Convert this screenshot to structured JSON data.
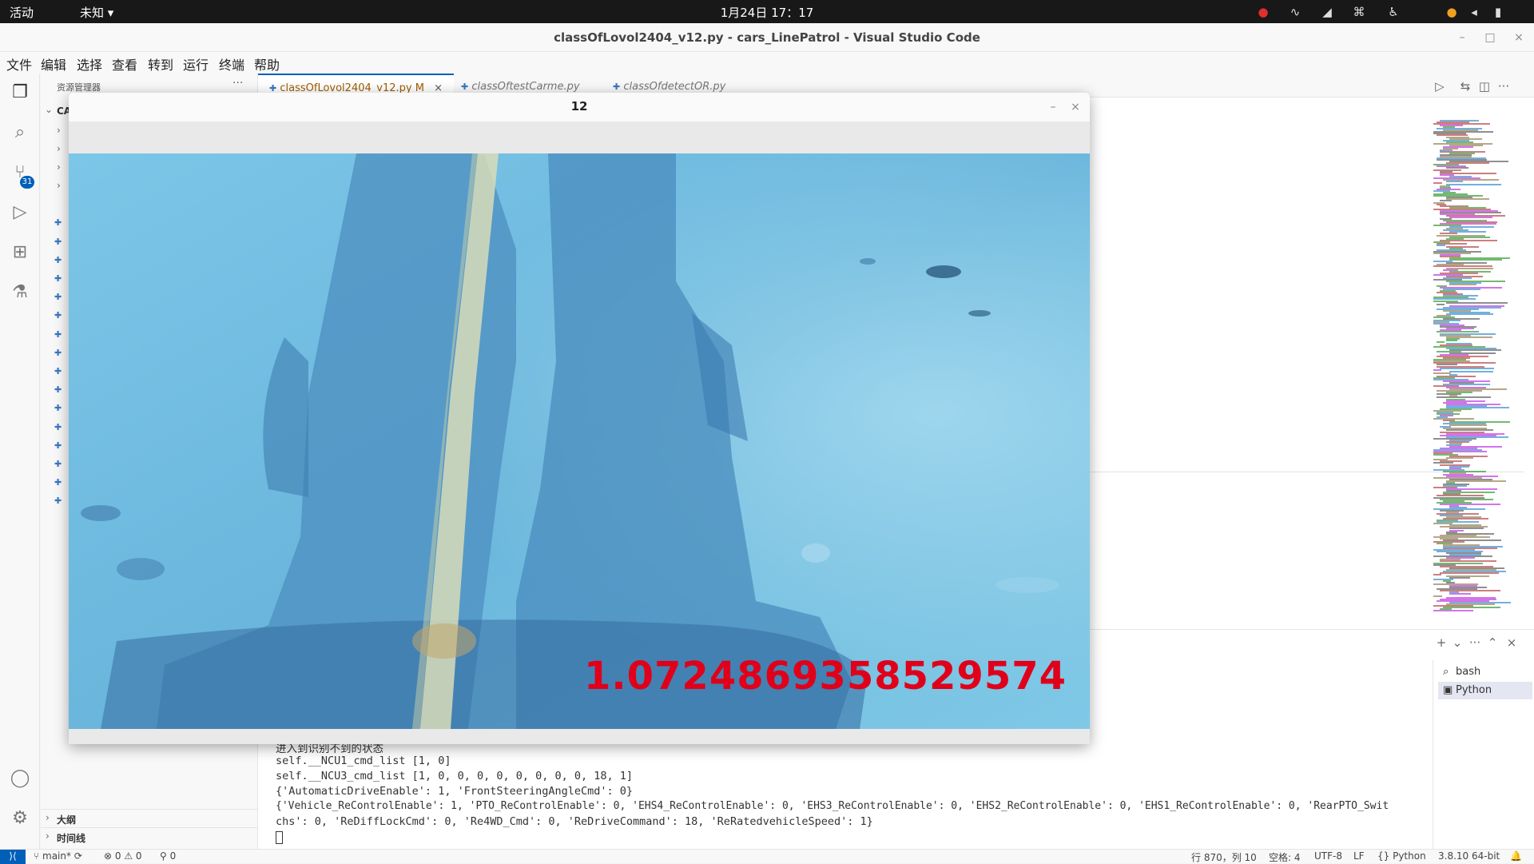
{
  "topbar": {
    "activities": "活动",
    "unknown": "未知 ▾",
    "clock": "1月24日  17：17"
  },
  "window": {
    "title": "classOfLovol2404_v12.py - cars_LinePatrol - Visual Studio Code"
  },
  "menu": [
    "文件",
    "编辑",
    "选择",
    "查看",
    "转到",
    "运行",
    "终端",
    "帮助"
  ],
  "activity": {
    "scm_badge": "31"
  },
  "sidebar": {
    "title": "资源管理器",
    "root": "CA",
    "outline": "大纲",
    "timeline": "时间线"
  },
  "tabs": [
    {
      "label": "classOfLovol2404_v12.py  M",
      "close": "×"
    },
    {
      "label": "classOftestCarme.py"
    },
    {
      "label": "classOfdetectOR.py"
    }
  ],
  "panel": {
    "lines": [
      "进入到识别不到的状态",
      "self.__NCU1_cmd_list [1, 0]",
      "self.__NCU3_cmd_list [1, 0, 0, 0, 0, 0, 0, 0, 0, 18, 1]",
      "{'AutomaticDriveEnable': 1, 'FrontSteeringAngleCmd': 0}",
      "{'Vehicle_ReControlEnable': 1, 'PTO_ReControlEnable': 0, 'EHS4_ReControlEnable': 0, 'EHS3_ReControlEnable': 0, 'EHS2_ReControlEnable': 0, 'EHS1_ReControlEnable': 0, 'RearPTO_Swit",
      "chs': 0, 'ReDiffLockCmd': 0, 'Re4WD_Cmd': 0, 'ReDriveCommand': 18, 'ReRatedvehicleSpeed': 1}"
    ],
    "terminals": [
      "bash",
      "Python"
    ]
  },
  "statusbar": {
    "branch": "main*",
    "errors": "0",
    "warnings": "0",
    "ports": "0",
    "position": "行 870，列 10",
    "spaces": "空格: 4",
    "encoding": "UTF-8",
    "eol": "LF",
    "language": "Python",
    "interpreter": "3.8.10 64-bit"
  },
  "cv_window": {
    "title": "12",
    "overlay_value": "1.0724869358529574"
  },
  "colors": {
    "accent": "#005fb8",
    "overlay_text": "#e0001a",
    "road_blue": "#6fb8de"
  }
}
